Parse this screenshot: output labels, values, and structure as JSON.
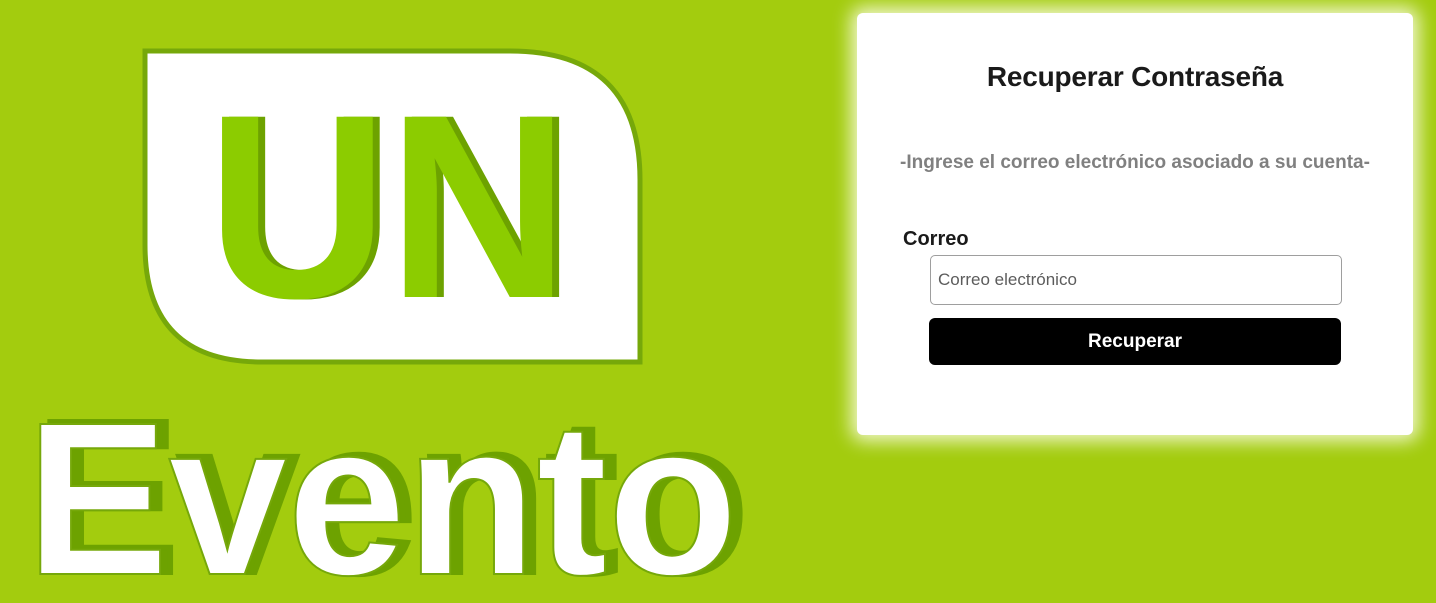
{
  "logo": {
    "top_text": "UN",
    "bottom_text": "Evento",
    "colors": {
      "background": "#a3cc0e",
      "badge_fill": "#ffffff",
      "badge_outline": "#76a80a",
      "letter_green": "#8ccc00",
      "letter_shadow": "#6da200",
      "evento_fill": "#ffffff",
      "evento_shadow": "#6da200"
    }
  },
  "recover_form": {
    "title": "Recuperar Contraseña",
    "subtitle": "-Ingrese el correo electrónico asociado a su cuenta-",
    "email_label": "Correo",
    "email_value": "",
    "email_placeholder": "Correo electrónico",
    "submit_label": "Recuperar",
    "colors": {
      "card": "#ffffff",
      "button": "#000000",
      "button_text": "#ffffff",
      "subtitle": "#808080"
    }
  }
}
